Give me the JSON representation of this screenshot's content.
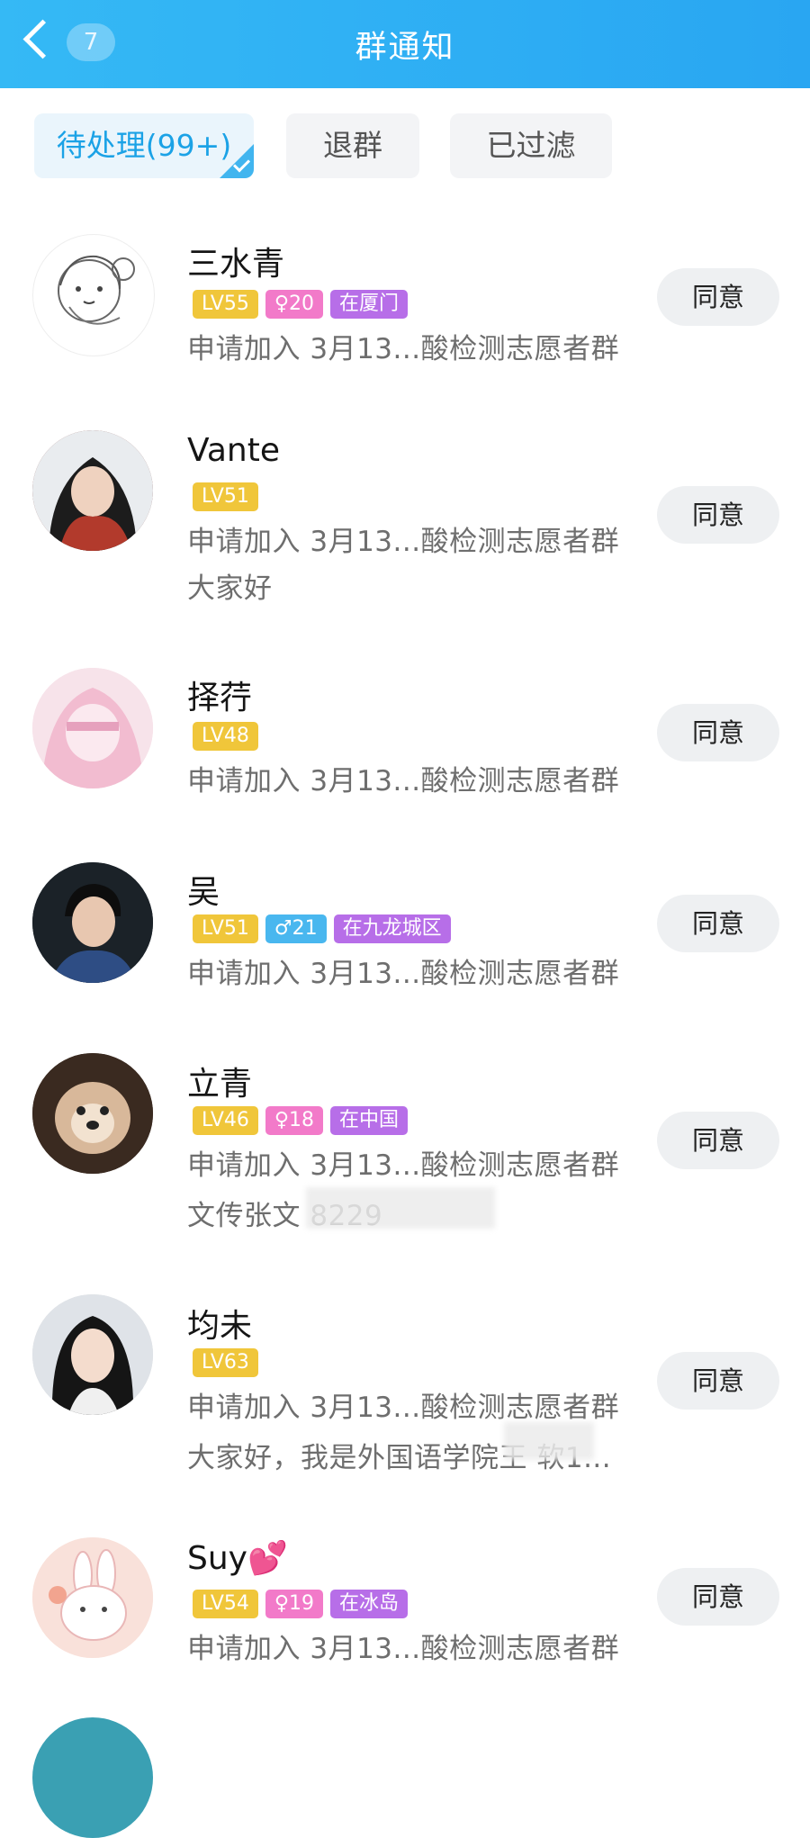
{
  "header": {
    "back_count": "7",
    "title": "群通知"
  },
  "tabs": [
    {
      "label": "待处理(99+)",
      "active": true
    },
    {
      "label": "退群",
      "active": false
    },
    {
      "label": "已过滤",
      "active": false
    }
  ],
  "agree_label": "同意",
  "requests": [
    {
      "name": "三水青",
      "level": "LV55",
      "gender": "female",
      "age": "20",
      "location": "在厦门",
      "request": "申请加入 3月13...酸检测志愿者群",
      "message": ""
    },
    {
      "name": "Vante",
      "level": "LV51",
      "gender": "",
      "age": "",
      "location": "",
      "request": "申请加入 3月13...酸检测志愿者群",
      "message": "大家好"
    },
    {
      "name": "择荇",
      "level": "LV48",
      "gender": "",
      "age": "",
      "location": "",
      "request": "申请加入 3月13...酸检测志愿者群",
      "message": ""
    },
    {
      "name": "吴",
      "level": "LV51",
      "gender": "male",
      "age": "21",
      "location": "在九龙城区",
      "request": "申请加入 3月13...酸检测志愿者群",
      "message": ""
    },
    {
      "name": "立青",
      "level": "LV46",
      "gender": "female",
      "age": "18",
      "location": "在中国",
      "request": "申请加入 3月13...酸检测志愿者群",
      "message": "文传张文        8229"
    },
    {
      "name": "均未",
      "level": "LV63",
      "gender": "",
      "age": "",
      "location": "",
      "request": "申请加入 3月13...酸检测志愿者群",
      "message": "大家好，我是外国语学院王    软1..."
    },
    {
      "name": "Suy💕",
      "level": "LV54",
      "gender": "female",
      "age": "19",
      "location": "在冰岛",
      "request": "申请加入 3月13...酸检测志愿者群",
      "message": ""
    }
  ],
  "colors": {
    "header": "#29a6f2",
    "active_tab": "#1ba2e6",
    "level_tag": "#f0c63a",
    "female_tag": "#f27ac9",
    "male_tag": "#49b7ef",
    "location_tag": "#b76ee8"
  }
}
